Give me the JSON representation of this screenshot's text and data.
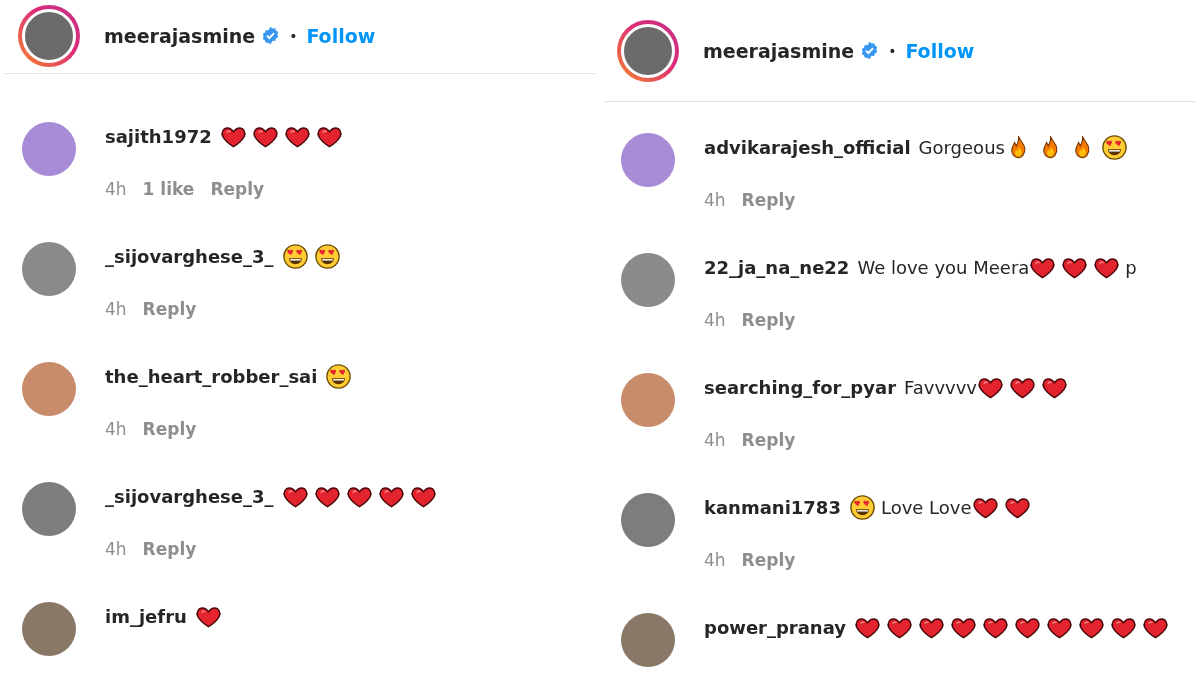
{
  "panels": [
    {
      "header": {
        "username": "meerajasmine",
        "verified": true,
        "separator": "•",
        "follow": "Follow"
      },
      "comments": [
        {
          "username": "sajith1972",
          "parts": [
            {
              "kind": "heart"
            },
            {
              "kind": "heart"
            },
            {
              "kind": "heart"
            },
            {
              "kind": "heart"
            }
          ],
          "time": "4h",
          "likes": "1 like",
          "reply": "Reply"
        },
        {
          "username": "_sijovarghese_3_",
          "parts": [
            {
              "kind": "heart_eyes"
            },
            {
              "kind": "heart_eyes"
            }
          ],
          "time": "4h",
          "reply": "Reply"
        },
        {
          "username": "the_heart_robber_sai",
          "parts": [
            {
              "kind": "heart_eyes"
            }
          ],
          "time": "4h",
          "reply": "Reply"
        },
        {
          "username": "_sijovarghese_3_",
          "parts": [
            {
              "kind": "heart"
            },
            {
              "kind": "heart"
            },
            {
              "kind": "heart"
            },
            {
              "kind": "heart"
            },
            {
              "kind": "heart"
            }
          ],
          "time": "4h",
          "reply": "Reply"
        },
        {
          "username": "im_jefru",
          "parts": [
            {
              "kind": "heart"
            }
          ]
        }
      ]
    },
    {
      "header": {
        "username": "meerajasmine",
        "verified": true,
        "separator": "•",
        "follow": "Follow"
      },
      "comments": [
        {
          "username": "advikarajesh_official",
          "parts": [
            {
              "kind": "text",
              "text": "Gorgeous"
            },
            {
              "kind": "fire"
            },
            {
              "kind": "fire"
            },
            {
              "kind": "fire"
            },
            {
              "kind": "heart_eyes"
            }
          ],
          "time": "4h",
          "reply": "Reply"
        },
        {
          "username": "22_ja_na_ne22",
          "parts": [
            {
              "kind": "text",
              "text": "We love you Meera"
            },
            {
              "kind": "heart"
            },
            {
              "kind": "heart"
            },
            {
              "kind": "heart"
            },
            {
              "kind": "text",
              "text": "p"
            }
          ],
          "time": "4h",
          "reply": "Reply"
        },
        {
          "username": "searching_for_pyar",
          "parts": [
            {
              "kind": "text",
              "text": "Favvvvv"
            },
            {
              "kind": "heart"
            },
            {
              "kind": "heart"
            },
            {
              "kind": "heart"
            }
          ],
          "time": "4h",
          "reply": "Reply"
        },
        {
          "username": "kanmani1783",
          "parts": [
            {
              "kind": "heart_eyes"
            },
            {
              "kind": "text",
              "text": "Love Love"
            },
            {
              "kind": "heart"
            },
            {
              "kind": "heart"
            }
          ],
          "time": "4h",
          "reply": "Reply"
        },
        {
          "username": "power_pranay",
          "parts": [
            {
              "kind": "heart"
            },
            {
              "kind": "heart"
            },
            {
              "kind": "heart"
            },
            {
              "kind": "heart"
            },
            {
              "kind": "heart"
            },
            {
              "kind": "heart"
            },
            {
              "kind": "heart"
            },
            {
              "kind": "heart"
            },
            {
              "kind": "heart"
            },
            {
              "kind": "heart"
            }
          ]
        }
      ]
    }
  ]
}
